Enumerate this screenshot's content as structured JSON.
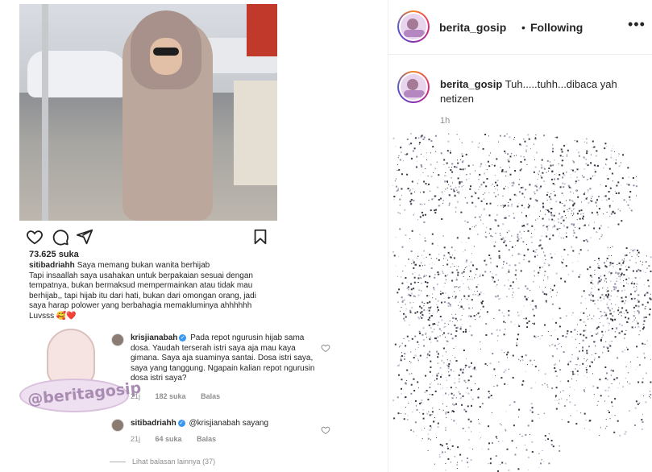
{
  "post": {
    "likes": "73.625 suka",
    "caption_user": "sitibadriahh",
    "caption_text": "Saya memang bukan wanita berhijab\nTapi insaallah saya usahakan untuk berpakaian sesuai dengan tempatnya, bukan bermaksud mempermainkan atau tidak mau berhijab,, tapi hijab itu dari hati, bukan dari omongan orang, jadi saya harap polower yang berbahagia memakluminya ahhhhhh\nLuvsss 🥰❤️",
    "icons": [
      "heart-icon",
      "comment-icon",
      "share-icon",
      "bookmark-icon"
    ]
  },
  "comments": [
    {
      "user": "krisjianabah",
      "verified": true,
      "text": "Pada repot ngurusin hijab sama dosa. Yaudah terserah istri saya aja mau kaya gimana. Saya aja suaminya santai. Dosa istri saya, saya yang tanggung. Ngapain kalian repot ngurusin dosa istri saya?",
      "time": "21j",
      "likes": "182 suka",
      "reply": "Balas"
    },
    {
      "user": "sitibadriahh",
      "verified": true,
      "text": "@krisjianabah sayang",
      "time": "21j",
      "likes": "64 suka",
      "reply": "Balas"
    }
  ],
  "more_replies": "Lihat balasan lainnya (37)",
  "watermark": "@beritagosip",
  "header": {
    "username": "berita_gosip",
    "separator": "•",
    "follow_status": "Following",
    "more": "•••"
  },
  "panel_caption": {
    "username": "berita_gosip",
    "text": "Tuh.....tuhh...dibaca yah netizen",
    "time": "1h"
  },
  "colors": {
    "text": "#262626",
    "muted": "#8e8e8e",
    "border": "#efefef",
    "verified": "#3897f0"
  }
}
